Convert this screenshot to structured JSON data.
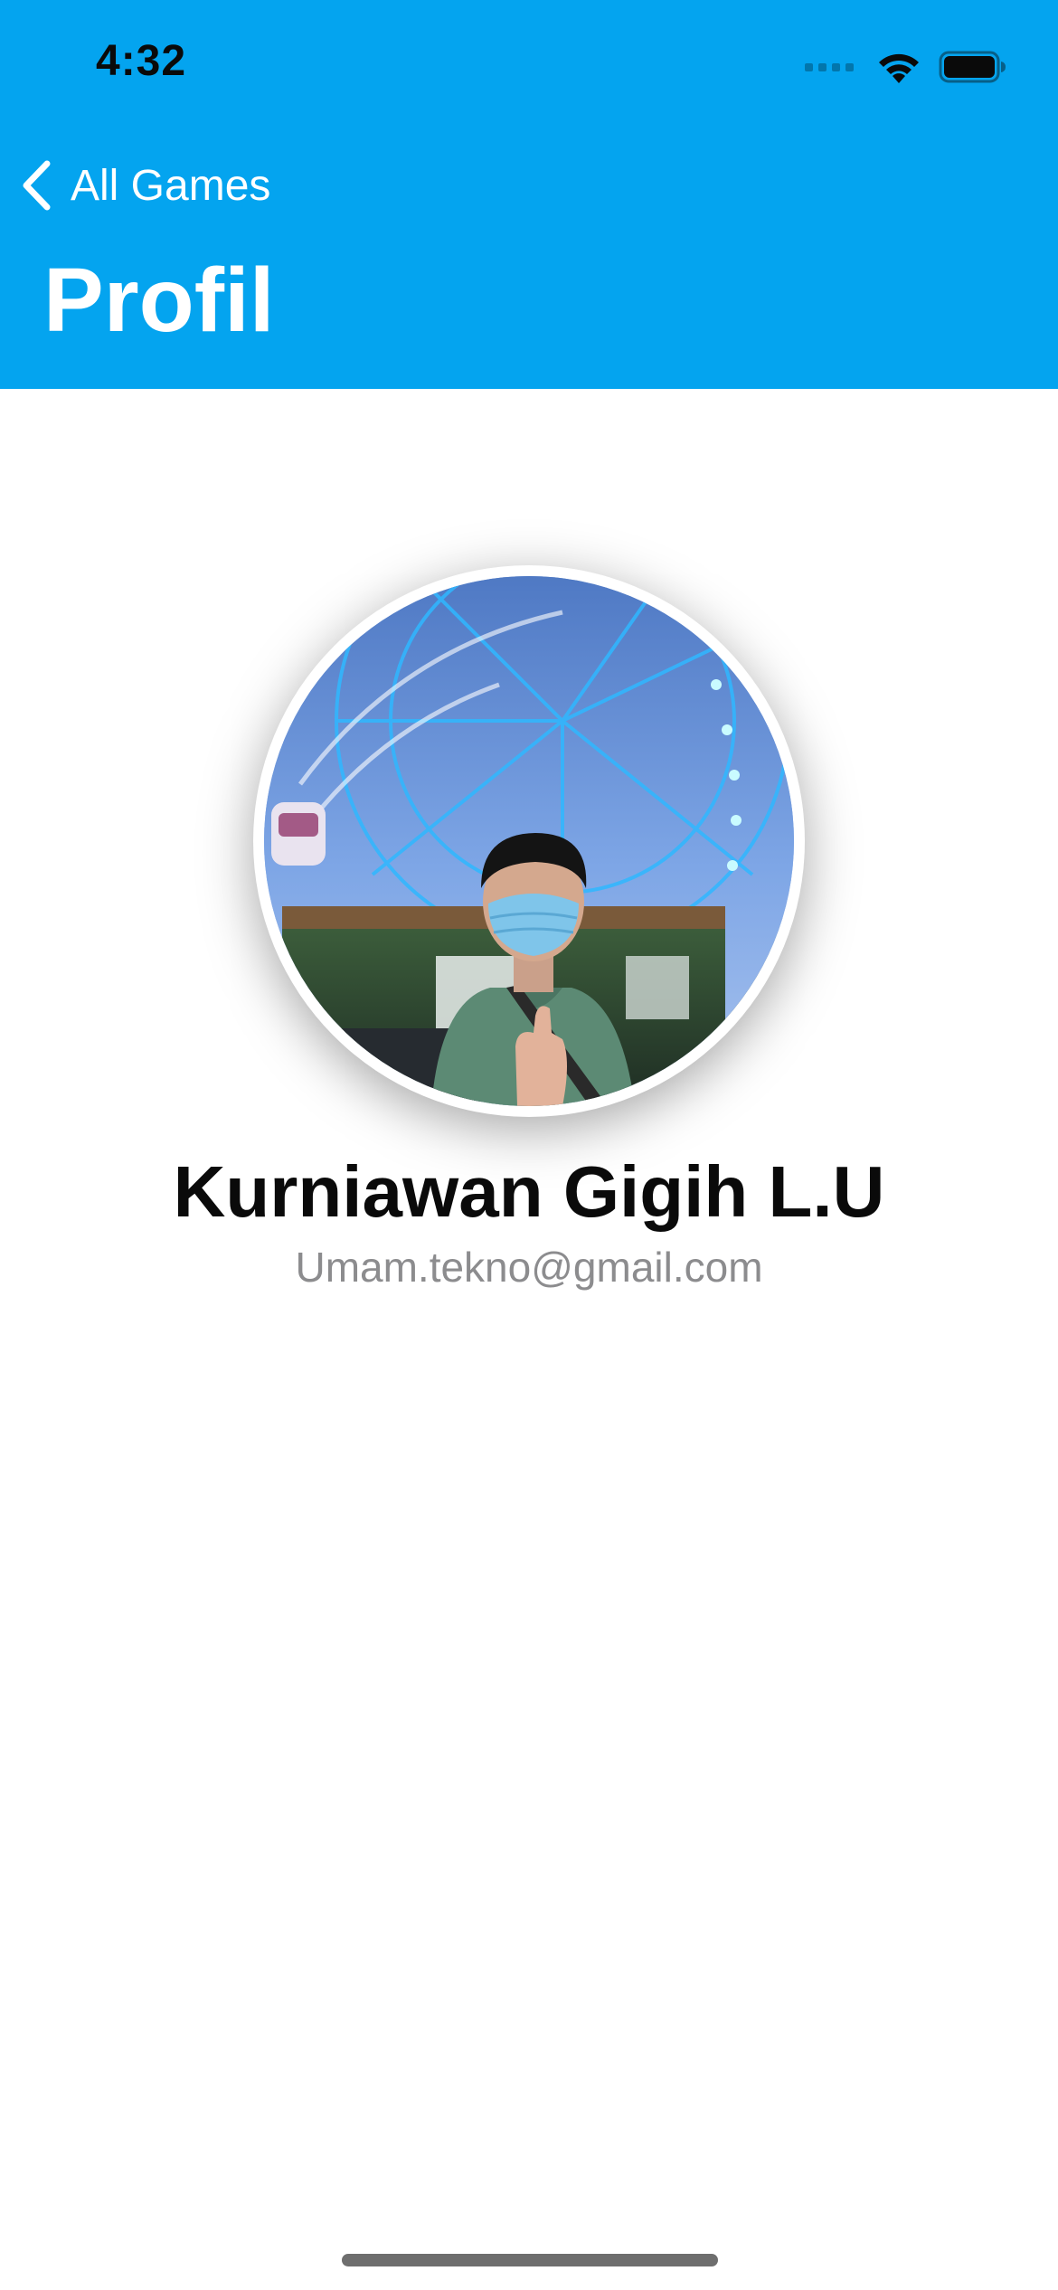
{
  "status_bar": {
    "time": "4:32"
  },
  "navigation": {
    "back_label": "All Games",
    "title": "Profil"
  },
  "profile": {
    "name": "Kurniawan Gigih L.U",
    "email": "Umam.tekno@gmail.com"
  },
  "colors": {
    "header_background": "#04a4ef",
    "title_text": "#ffffff",
    "name_text": "#0a0a0a",
    "email_text": "#8c8c8e"
  },
  "icons": {
    "back": "chevron-left-icon",
    "signal": "cellular-signal-icon",
    "wifi": "wifi-icon",
    "battery": "battery-icon"
  }
}
